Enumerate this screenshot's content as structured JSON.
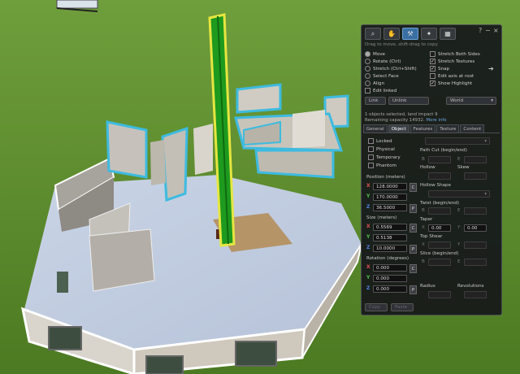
{
  "toolbar": {
    "tools": [
      {
        "icon": "magnifier-icon"
      },
      {
        "icon": "hand-icon"
      },
      {
        "icon": "build-icon"
      },
      {
        "icon": "shovel-icon"
      },
      {
        "icon": "land-icon"
      }
    ],
    "help_glyph": "?",
    "minimize_glyph": "−",
    "close_glyph": "×"
  },
  "hint": "Drag to move, shift-drag to copy",
  "edit_modes": [
    {
      "label": "Move",
      "selected": true
    },
    {
      "label": "Rotate (Ctrl)",
      "selected": false
    },
    {
      "label": "Stretch (Ctrl+Shift)",
      "selected": false
    },
    {
      "label": "Select Face",
      "selected": false
    },
    {
      "label": "Align",
      "selected": false
    }
  ],
  "edit_linked": {
    "label": "Edit linked",
    "checked": false
  },
  "options": [
    {
      "label": "Stretch Both Sides",
      "checked": false
    },
    {
      "label": "Stretch Textures",
      "checked": true
    },
    {
      "label": "Snap",
      "checked": true
    },
    {
      "label": "Edit axis at root",
      "checked": false
    },
    {
      "label": "Show Highlight",
      "checked": true
    }
  ],
  "link_buttons": {
    "link": "Link",
    "unlink": "Unlink"
  },
  "ruler_select": "World",
  "info": {
    "selected": "1 objects selected, land impact 9",
    "remaining": "Remaining capacity 14932.",
    "more_info": "More info"
  },
  "tabs": [
    {
      "label": "General",
      "active": false
    },
    {
      "label": "Object",
      "active": true
    },
    {
      "label": "Features",
      "active": false
    },
    {
      "label": "Texture",
      "active": false
    },
    {
      "label": "Content",
      "active": false
    }
  ],
  "flags": [
    {
      "label": "Locked",
      "checked": false
    },
    {
      "label": "Physical",
      "checked": false
    },
    {
      "label": "Temporary",
      "checked": false
    },
    {
      "label": "Phantom",
      "checked": false
    }
  ],
  "position": {
    "label": "Position (meters)",
    "x": "128.0000",
    "y": "170.0000",
    "z": "36.5000"
  },
  "size": {
    "label": "Size (meters)",
    "x": "0.5569",
    "y": "0.5138",
    "z": "10.0000"
  },
  "rotation": {
    "label": "Rotation (degrees)",
    "x": "0.000",
    "y": "0.000",
    "z": "0.000"
  },
  "axis_letters": {
    "x": "X",
    "y": "Y",
    "z": "Z",
    "b": "B",
    "e": "E"
  },
  "side_buttons": {
    "copy": "C",
    "paste": "P"
  },
  "shape": {
    "path_cut": "Path Cut (begin/end)",
    "hollow": "Hollow",
    "skew": "Skew",
    "hollow_shape": "Hollow Shape",
    "twist": "Twist (begin/end)",
    "taper": "Taper",
    "taper_x": "0.00",
    "taper_y": "0.00",
    "top_shear": "Top Shear",
    "slice": "Slice (begin/end)",
    "radius": "Radius",
    "revolutions": "Revolutions"
  },
  "bottom_buttons": {
    "copy": "Copy",
    "paste": "Paste"
  },
  "colors": {
    "panel_bg": "#16181a",
    "accent": "#3a6fa3",
    "grass": "#5a8a2a",
    "selection": "#e6e640"
  }
}
